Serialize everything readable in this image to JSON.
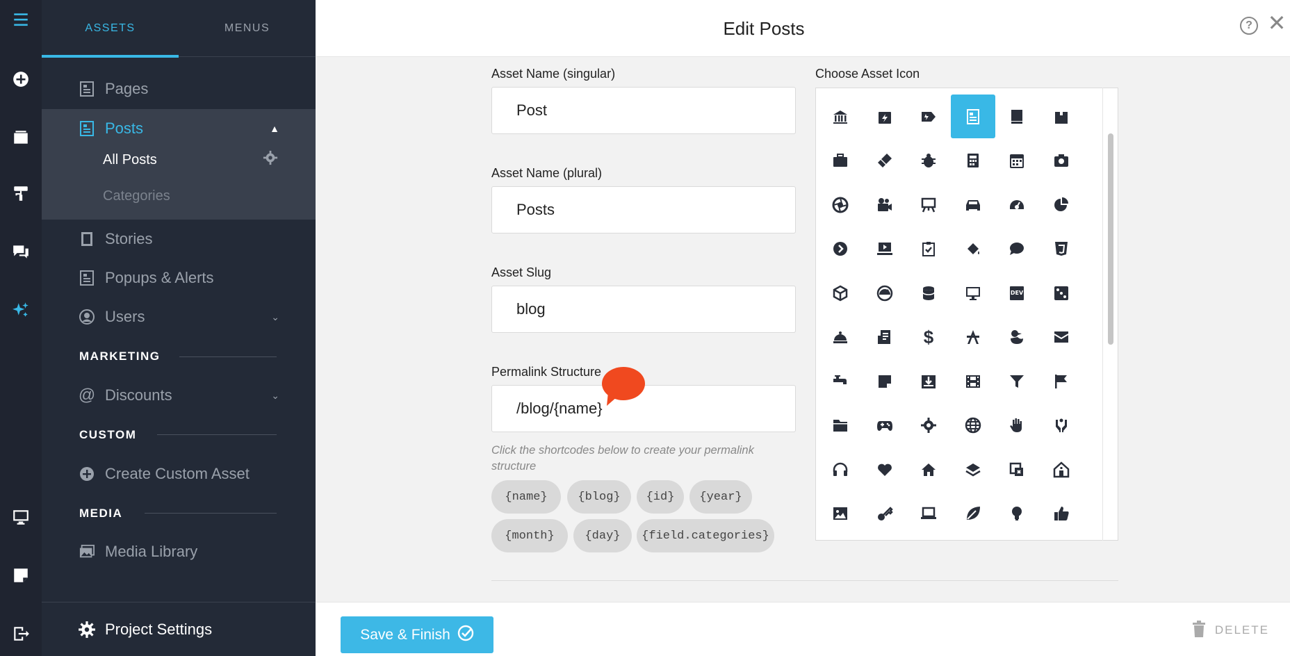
{
  "rail": {
    "icons": [
      "menu-icon",
      "add-circle-icon",
      "window-icon",
      "paint-roller-icon",
      "chat-icon",
      "magic-icon",
      "monitor-icon",
      "sticky-note-icon",
      "exit-icon"
    ]
  },
  "sidebar": {
    "tabs": [
      "ASSETS",
      "MENUS"
    ],
    "items": {
      "pages": "Pages",
      "posts": "Posts",
      "all_posts": "All Posts",
      "categories": "Categories",
      "stories": "Stories",
      "popups": "Popups & Alerts",
      "users": "Users",
      "discounts": "Discounts",
      "create_custom": "Create Custom Asset",
      "media_library": "Media Library"
    },
    "sections": {
      "marketing": "MARKETING",
      "custom": "CUSTOM",
      "media": "MEDIA"
    },
    "project_settings": "Project Settings"
  },
  "header": {
    "title": "Edit Posts"
  },
  "form": {
    "singular_label": "Asset Name (singular)",
    "singular_value": "Post",
    "plural_label": "Asset Name (plural)",
    "plural_value": "Posts",
    "slug_label": "Asset Slug",
    "slug_value": "blog",
    "permalink_label": "Permalink Structure",
    "permalink_value": "/blog/{name}",
    "hint": "Click the shortcodes below to create your permalink structure",
    "shortcodes": [
      "{name}",
      "{blog}",
      "{id}",
      "{year}",
      "{month}",
      "{day}",
      "{field.categories}"
    ]
  },
  "icon_chooser": {
    "label": "Choose Asset Icon",
    "selected_index": 3,
    "icons": [
      "bank-icon",
      "calendar-bolt-icon",
      "tag-battery-icon",
      "article-icon",
      "book-icon",
      "box-icon",
      "briefcase-icon",
      "brush-icon",
      "bug-icon",
      "calculator-icon",
      "calendar-icon",
      "camera-icon",
      "aperture-icon",
      "video-camera-icon",
      "easel-icon",
      "car-icon",
      "gauge-icon",
      "pie-chart-icon",
      "play-circle-icon",
      "laptop-play-icon",
      "clipboard-check-icon",
      "paint-drop-icon",
      "comment-icon",
      "css3-icon",
      "cube-icon",
      "dashboard-icon",
      "database-icon",
      "desktop-icon",
      "dev-icon",
      "dice-icon",
      "bell-icon",
      "receipt-icon",
      "dollar-icon",
      "compass-a-icon",
      "duck-icon",
      "envelope-icon",
      "faucet-icon",
      "note-icon",
      "download-box-icon",
      "film-icon",
      "filter-icon",
      "flag-icon",
      "folder-icon",
      "gamepad-icon",
      "gear-icon",
      "globe-icon",
      "hand-icon",
      "hands-icon",
      "headphones-icon",
      "heart-icon",
      "home-icon",
      "layers-icon",
      "lab-icon",
      "house-icon",
      "image-icon",
      "key-icon",
      "laptop-icon",
      "leaf-icon",
      "lightbulb-icon",
      "thumbs-up-icon"
    ],
    "dollar_glyph": "$",
    "dev_glyph": "DEV"
  },
  "footer": {
    "save_label": "Save & Finish",
    "delete_label": "DELETE"
  },
  "colors": {
    "accent": "#39b8e6",
    "sidebar_bg": "#232a37",
    "rail_bg": "#1f2430"
  }
}
